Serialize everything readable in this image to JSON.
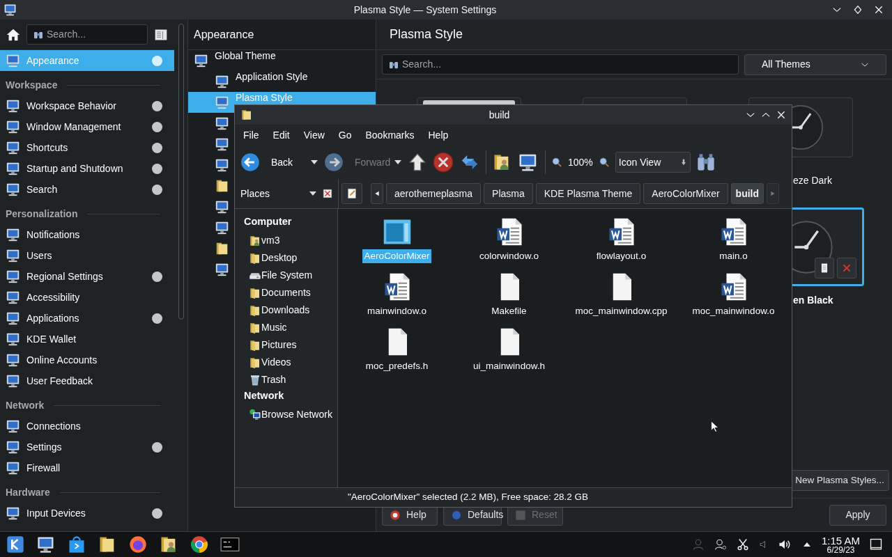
{
  "window": {
    "title": "Plasma Style — System Settings"
  },
  "sidebar": {
    "search": {
      "placeholder": "Search..."
    },
    "items": [
      {
        "kind": "item",
        "label": "Appearance",
        "selected": true,
        "modified": true
      },
      {
        "kind": "header",
        "label": "Workspace"
      },
      {
        "kind": "item",
        "label": "Workspace Behavior",
        "selected": false,
        "modified": true
      },
      {
        "kind": "item",
        "label": "Window Management",
        "selected": false,
        "modified": true
      },
      {
        "kind": "item",
        "label": "Shortcuts",
        "selected": false,
        "modified": true
      },
      {
        "kind": "item",
        "label": "Startup and Shutdown",
        "selected": false,
        "modified": true
      },
      {
        "kind": "item",
        "label": "Search",
        "selected": false,
        "modified": true
      },
      {
        "kind": "header",
        "label": "Personalization"
      },
      {
        "kind": "item",
        "label": "Notifications",
        "selected": false,
        "modified": false
      },
      {
        "kind": "item",
        "label": "Users",
        "selected": false,
        "modified": false
      },
      {
        "kind": "item",
        "label": "Regional Settings",
        "selected": false,
        "modified": true
      },
      {
        "kind": "item",
        "label": "Accessibility",
        "selected": false,
        "modified": false
      },
      {
        "kind": "item",
        "label": "Applications",
        "selected": false,
        "modified": true
      },
      {
        "kind": "item",
        "label": "KDE Wallet",
        "selected": false,
        "modified": false
      },
      {
        "kind": "item",
        "label": "Online Accounts",
        "selected": false,
        "modified": false
      },
      {
        "kind": "item",
        "label": "User Feedback",
        "selected": false,
        "modified": false
      },
      {
        "kind": "header",
        "label": "Network"
      },
      {
        "kind": "item",
        "label": "Connections",
        "selected": false,
        "modified": false
      },
      {
        "kind": "item",
        "label": "Settings",
        "selected": false,
        "modified": true
      },
      {
        "kind": "item",
        "label": "Firewall",
        "selected": false,
        "modified": false
      },
      {
        "kind": "header",
        "label": "Hardware"
      },
      {
        "kind": "item",
        "label": "Input Devices",
        "selected": false,
        "modified": true
      }
    ]
  },
  "category": {
    "title": "Appearance",
    "items": [
      {
        "label": "Global Theme",
        "selected": false,
        "children": [
          {
            "label": "Application Style",
            "selected": false
          },
          {
            "label": "Plasma Style",
            "selected": true
          }
        ]
      }
    ]
  },
  "content": {
    "title": "Plasma Style",
    "search": {
      "placeholder": "Search..."
    },
    "filter": {
      "value": "All Themes"
    },
    "themes": [
      {
        "name": "eze Dark",
        "selected": false
      },
      {
        "name": "en Black",
        "selected": true
      }
    ],
    "new_button": "New Plasma Styles...",
    "footer_buttons": [
      {
        "label": "Help",
        "disabled": false
      },
      {
        "label": "Defaults",
        "disabled": false
      },
      {
        "label": "Reset",
        "disabled": true
      },
      {
        "label": "Apply",
        "disabled": false
      }
    ]
  },
  "file_manager": {
    "title": "build",
    "menu": [
      "File",
      "Edit",
      "View",
      "Go",
      "Bookmarks",
      "Help"
    ],
    "toolbar": {
      "back": {
        "label": "Back",
        "disabled": false
      },
      "forward": {
        "label": "Forward",
        "disabled": true
      },
      "zoom": "100%",
      "view_mode": "Icon View"
    },
    "places": {
      "title": "Places",
      "groups": [
        {
          "label": "Computer",
          "items": [
            {
              "label": "vm3",
              "kind": "home"
            },
            {
              "label": "Desktop",
              "kind": "folder"
            },
            {
              "label": "File System",
              "kind": "drive"
            },
            {
              "label": "Documents",
              "kind": "folder"
            },
            {
              "label": "Downloads",
              "kind": "folder"
            },
            {
              "label": "Music",
              "kind": "folder"
            },
            {
              "label": "Pictures",
              "kind": "folder"
            },
            {
              "label": "Videos",
              "kind": "folder"
            },
            {
              "label": "Trash",
              "kind": "trash"
            }
          ]
        },
        {
          "label": "Network",
          "items": [
            {
              "label": "Browse Network",
              "kind": "network"
            }
          ]
        }
      ]
    },
    "breadcrumb": [
      {
        "label": "aerothemeplasma",
        "selected": false
      },
      {
        "label": "Plasma",
        "selected": false
      },
      {
        "label": "KDE Plasma Theme",
        "selected": false
      },
      {
        "label": "AeroColorMixer",
        "selected": false
      },
      {
        "label": "build",
        "selected": true
      }
    ],
    "files": [
      {
        "name": "AeroColorMixer",
        "kind": "app",
        "selected": true
      },
      {
        "name": "colorwindow.o",
        "kind": "document",
        "selected": false
      },
      {
        "name": "flowlayout.o",
        "kind": "document",
        "selected": false
      },
      {
        "name": "main.o",
        "kind": "document",
        "selected": false
      },
      {
        "name": "mainwindow.o",
        "kind": "document",
        "selected": false
      },
      {
        "name": "Makefile",
        "kind": "blank",
        "selected": false
      },
      {
        "name": "moc_mainwindow.cpp",
        "kind": "blank",
        "selected": false
      },
      {
        "name": "moc_mainwindow.o",
        "kind": "document",
        "selected": false
      },
      {
        "name": "moc_predefs.h",
        "kind": "blank",
        "selected": false
      },
      {
        "name": "ui_mainwindow.h",
        "kind": "blank",
        "selected": false
      }
    ],
    "status": "\"AeroColorMixer\" selected (2.2 MB), Free space: 28.2 GB"
  },
  "taskbar": {
    "clock": {
      "time": "1:15 AM",
      "date": "6/29/23"
    }
  }
}
